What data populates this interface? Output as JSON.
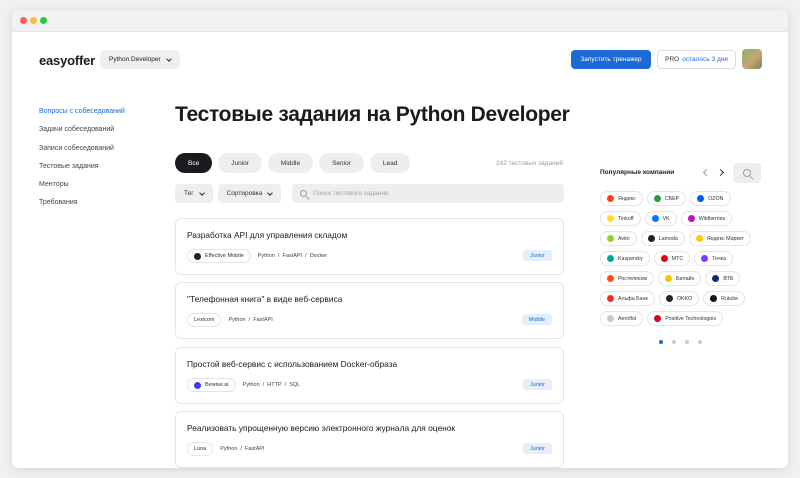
{
  "header": {
    "logo": "easyoffer",
    "profession": "Python Developer",
    "start_trainer": "Запустить тренажер",
    "pro_label": "PRO",
    "pro_remaining": "осталось 3 дня"
  },
  "sidebar": {
    "items": [
      {
        "label": "Вопросы с собеседований",
        "active": true
      },
      {
        "label": "Задачи собеседований"
      },
      {
        "label": "Записи собеседований"
      },
      {
        "label": "Тестовые задания"
      },
      {
        "label": "Менторы"
      },
      {
        "label": "Требования"
      }
    ]
  },
  "main": {
    "title": "Тестовые задания на Python Developer",
    "levels": [
      "Все",
      "Junior",
      "Middle",
      "Senior",
      "Lead"
    ],
    "task_count": "242 тестовых заданий",
    "filter_tag": "Тег",
    "filter_sort": "Сортировка",
    "search_placeholder": "Поиск тестового задания",
    "tasks": [
      {
        "title": "Разработка API для управления складом",
        "company": "Effective Mobile",
        "tags": "Python  /  FastAPI  /  Docker",
        "level": "Junior"
      },
      {
        "title": "\"Телефонная книга\" в виде веб-сервиса",
        "company": "Lexicom",
        "tags": "Python  /  FastAPI",
        "level": "Middle"
      },
      {
        "title": "Простой веб-сервис с использованием Docker-образа",
        "company": "Bewise.ai",
        "tags": "Python  /  HTTP  /  SQL",
        "level": "Junior"
      },
      {
        "title": "Реализовать упрощенную версию электронного журнала для оценок",
        "company": "Luna",
        "tags": "Python  /  FastAPI",
        "level": "Junior"
      }
    ]
  },
  "popular": {
    "title": "Популярные компании",
    "companies": [
      {
        "name": "Яндекс",
        "color": "#fc3f1d"
      },
      {
        "name": "СБЕР",
        "color": "#21a038"
      },
      {
        "name": "OZON",
        "color": "#005bff"
      },
      {
        "name": "Tinkoff",
        "color": "#ffdd2d"
      },
      {
        "name": "VK",
        "color": "#0077ff"
      },
      {
        "name": "Wildberries",
        "color": "#cb11ab"
      },
      {
        "name": "Avito",
        "color": "#97cf26"
      },
      {
        "name": "Lamoda",
        "color": "#222222"
      },
      {
        "name": "Яндекс Маркет",
        "color": "#ffcc00"
      },
      {
        "name": "Kaspersky",
        "color": "#00a88e"
      },
      {
        "name": "МТС",
        "color": "#e30611"
      },
      {
        "name": "Точка",
        "color": "#7a3cff"
      },
      {
        "name": "Ростелеком",
        "color": "#ff4f12"
      },
      {
        "name": "Билайн",
        "color": "#f7c600"
      },
      {
        "name": "ВТБ",
        "color": "#0a2973"
      },
      {
        "name": "Альфа Банк",
        "color": "#ef3124"
      },
      {
        "name": "OKKO",
        "color": "#222222"
      },
      {
        "name": "Rutube",
        "color": "#111111"
      },
      {
        "name": "Aeroflot",
        "color": "#c9c9d0"
      },
      {
        "name": "Positive Technologies",
        "color": "#d6001c"
      }
    ]
  },
  "task_company_colors": [
    "#222222",
    "#ffffff",
    "#3d3bf3",
    "#ffffff"
  ]
}
